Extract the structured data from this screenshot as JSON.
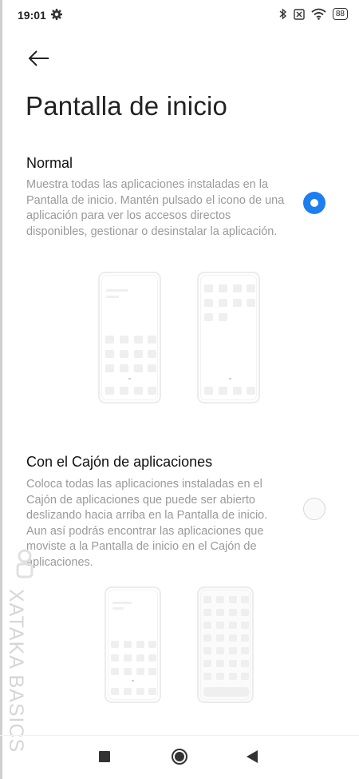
{
  "status_bar": {
    "time": "19:01",
    "battery": "88",
    "icons": [
      "gear-icon",
      "bluetooth-icon",
      "no-sim-icon",
      "wifi-icon",
      "battery-icon"
    ]
  },
  "header": {
    "back_icon": "back-arrow-icon",
    "title": "Pantalla de inicio"
  },
  "options": [
    {
      "title": "Normal",
      "description": "Muestra todas las aplicaciones instaladas en la Pantalla de inicio. Mantén pulsado el icono de una aplicación para ver los accesos directos disponibles, gestionar o desinstalar la aplicación.",
      "selected": true
    },
    {
      "title": "Con el Cajón de aplicaciones",
      "description": "Coloca todas las aplicaciones instaladas en el Cajón de aplicaciones que puede ser abierto deslizando hacia arriba en la Pantalla de inicio. Aun así podrás encontrar las aplicaciones que moviste a la Pantalla de inicio en el Cajón de aplicaciones.",
      "selected": false
    }
  ],
  "nav_bar": {
    "buttons": [
      "recents-square-icon",
      "home-circle-icon",
      "back-triangle-icon"
    ]
  },
  "watermark": {
    "text": "XATAKA BASICS"
  },
  "colors": {
    "accent": "#1d7ef0",
    "description_text": "#9a9a9a"
  }
}
